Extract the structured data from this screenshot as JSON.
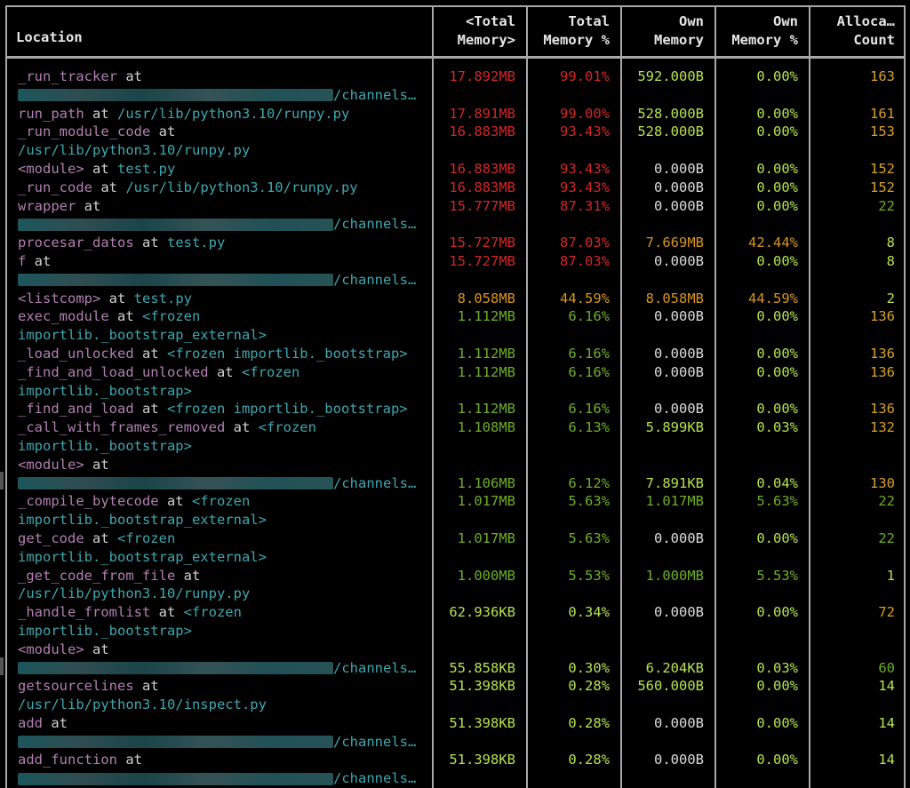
{
  "header": {
    "location": "Location",
    "total_memory": "<Total\nMemory>",
    "total_memory_pct": "Total\nMemory %",
    "own_memory": "Own\nMemory",
    "own_memory_pct": "Own\nMemory %",
    "alloc_count": "Alloca…\nCount"
  },
  "rows": [
    {
      "fn": "_run_tracker",
      "at": " at",
      "path": "/channels…",
      "path_line2": true,
      "blurred": true,
      "tm": "17.892MB",
      "tp": "99.01%",
      "om": "592.000B",
      "op": "0.00%",
      "ac": "163"
    },
    {
      "fn": "run_path",
      "at": " at ",
      "path": "/usr/lib/python3.10/runpy.py",
      "tm": "17.891MB",
      "tp": "99.00%",
      "om": "528.000B",
      "op": "0.00%",
      "ac": "161"
    },
    {
      "fn": "_run_module_code",
      "at": " at",
      "path": "/usr/lib/python3.10/runpy.py",
      "path_line2": true,
      "tm": "16.883MB",
      "tp": "93.43%",
      "om": "528.000B",
      "op": "0.00%",
      "ac": "153"
    },
    {
      "fn": "<module>",
      "at": " at ",
      "path": "test.py",
      "tm": "16.883MB",
      "tp": "93.43%",
      "om": "0.000B",
      "op": "0.00%",
      "ac": "152"
    },
    {
      "fn": "_run_code",
      "at": " at ",
      "path": "/usr/lib/python3.10/runpy.py",
      "tm": "16.883MB",
      "tp": "93.43%",
      "om": "0.000B",
      "op": "0.00%",
      "ac": "152"
    },
    {
      "fn": "wrapper",
      "at": " at",
      "path": "/channels…",
      "path_line2": true,
      "blurred": true,
      "tm": "15.777MB",
      "tp": "87.31%",
      "om": "0.000B",
      "op": "0.00%",
      "ac": "22"
    },
    {
      "fn": "procesar_datos",
      "at": " at ",
      "path": "test.py",
      "tm": "15.727MB",
      "tp": "87.03%",
      "om": "7.669MB",
      "op": "42.44%",
      "ac": "8"
    },
    {
      "fn": "f",
      "at": " at",
      "path": "/channels…",
      "path_line2": true,
      "blurred": true,
      "tm": "15.727MB",
      "tp": "87.03%",
      "om": "0.000B",
      "op": "0.00%",
      "ac": "8"
    },
    {
      "fn": "<listcomp>",
      "at": " at ",
      "path": "test.py",
      "tm": "8.058MB",
      "tp": "44.59%",
      "om": "8.058MB",
      "op": "44.59%",
      "ac": "2"
    },
    {
      "fn": "exec_module",
      "at": " at ",
      "path": "<frozen",
      "path2": "importlib._bootstrap_external>",
      "tm": "1.112MB",
      "tp": "6.16%",
      "om": "0.000B",
      "op": "0.00%",
      "ac": "136"
    },
    {
      "fn": "_load_unlocked",
      "at": " at ",
      "path": "<frozen importlib._bootstrap>",
      "tm": "1.112MB",
      "tp": "6.16%",
      "om": "0.000B",
      "op": "0.00%",
      "ac": "136"
    },
    {
      "fn": "_find_and_load_unlocked",
      "at": " at ",
      "path": "<frozen",
      "path2": "importlib._bootstrap>",
      "tm": "1.112MB",
      "tp": "6.16%",
      "om": "0.000B",
      "op": "0.00%",
      "ac": "136"
    },
    {
      "fn": "_find_and_load",
      "at": " at ",
      "path": "<frozen importlib._bootstrap>",
      "tm": "1.112MB",
      "tp": "6.16%",
      "om": "0.000B",
      "op": "0.00%",
      "ac": "136"
    },
    {
      "fn": "_call_with_frames_removed",
      "at": " at ",
      "path": "<frozen",
      "path2": "importlib._bootstrap>",
      "tm": "1.108MB",
      "tp": "6.13%",
      "om": "5.899KB",
      "op": "0.03%",
      "ac": "132"
    },
    {
      "fn": "<module>",
      "at": " at",
      "path": "/channels…",
      "path_line2": true,
      "blurred": true,
      "tm": "1.106MB",
      "tp": "6.12%",
      "om": "7.891KB",
      "op": "0.04%",
      "ac": "130",
      "num_line2": true
    },
    {
      "fn": "_compile_bytecode",
      "at": " at ",
      "path": "<frozen",
      "path2": "importlib._bootstrap_external>",
      "tm": "1.017MB",
      "tp": "5.63%",
      "om": "1.017MB",
      "op": "5.63%",
      "ac": "22"
    },
    {
      "fn": "get_code",
      "at": " at ",
      "path": "<frozen",
      "path2": "importlib._bootstrap_external>",
      "tm": "1.017MB",
      "tp": "5.63%",
      "om": "0.000B",
      "op": "0.00%",
      "ac": "22"
    },
    {
      "fn": "_get_code_from_file",
      "at": " at",
      "path": "/usr/lib/python3.10/runpy.py",
      "path_line2": true,
      "tm": "1.000MB",
      "tp": "5.53%",
      "om": "1.000MB",
      "op": "5.53%",
      "ac": "1"
    },
    {
      "fn": "_handle_fromlist",
      "at": " at ",
      "path": "<frozen",
      "path2": "importlib._bootstrap>",
      "tm": "62.936KB",
      "tp": "0.34%",
      "om": "0.000B",
      "op": "0.00%",
      "ac": "72"
    },
    {
      "fn": "<module>",
      "at": " at",
      "path": "/channels…",
      "path_line2": true,
      "blurred": true,
      "tm": "55.858KB",
      "tp": "0.30%",
      "om": "6.204KB",
      "op": "0.03%",
      "ac": "60",
      "num_line2": true
    },
    {
      "fn": "getsourcelines",
      "at": " at",
      "path": "/usr/lib/python3.10/inspect.py",
      "path_line2": true,
      "tm": "51.398KB",
      "tp": "0.28%",
      "om": "560.000B",
      "op": "0.00%",
      "ac": "14"
    },
    {
      "fn": "add",
      "at": " at",
      "path": "/channels…",
      "path_line2": true,
      "blurred": true,
      "tm": "51.398KB",
      "tp": "0.28%",
      "om": "0.000B",
      "op": "0.00%",
      "ac": "14"
    },
    {
      "fn": "add_function",
      "at": " at",
      "path": "/channels…",
      "path_line2": true,
      "blurred": true,
      "tm": "51.398KB",
      "tp": "0.28%",
      "om": "0.000B",
      "op": "0.00%",
      "ac": "14"
    }
  ]
}
